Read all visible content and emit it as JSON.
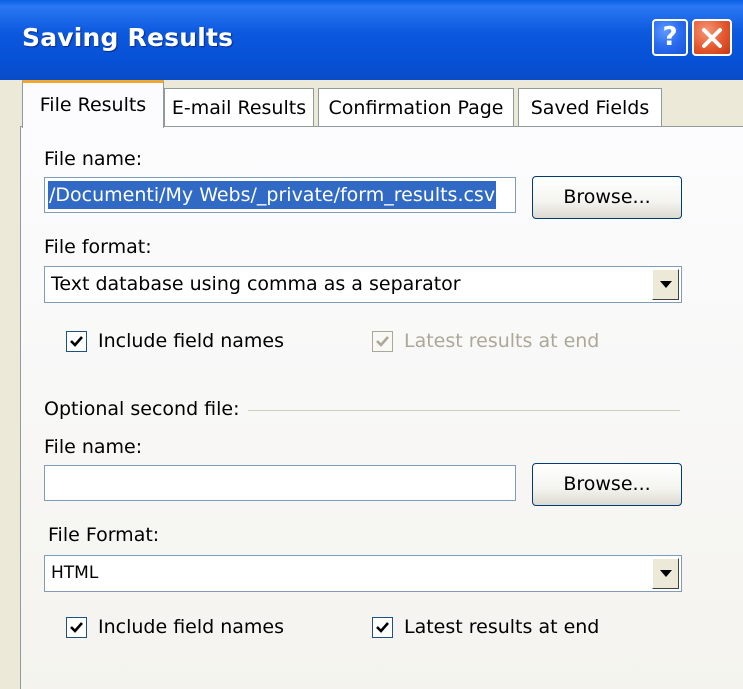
{
  "window": {
    "title": "Saving Results",
    "help_label": "?"
  },
  "tabs": [
    {
      "label": "File Results",
      "active": true
    },
    {
      "label": "E-mail Results",
      "active": false
    },
    {
      "label": "Confirmation Page",
      "active": false
    },
    {
      "label": "Saved Fields",
      "active": false
    }
  ],
  "primary": {
    "file_name_label": "File name:",
    "file_name_value": "/Documenti/My Webs/_private/form_results.csv",
    "browse_label": "Browse...",
    "file_format_label": "File format:",
    "file_format_value": "Text database using comma as a separator",
    "include_field_names_label": "Include field names",
    "include_field_names_checked": true,
    "latest_results_label": "Latest results at end",
    "latest_results_checked": true,
    "latest_results_disabled": true
  },
  "secondary": {
    "group_label": "Optional second file:",
    "file_name_label": "File name:",
    "file_name_value": "",
    "browse_label": "Browse...",
    "file_format_label": "File Format:",
    "file_format_value": "HTML",
    "include_field_names_label": "Include field names",
    "include_field_names_checked": true,
    "latest_results_label": "Latest results at end",
    "latest_results_checked": true
  },
  "colors": {
    "titlebar": "#0a5fe4",
    "selection": "#316ac5",
    "active_tab_accent": "#f0a830",
    "close_button": "#e4582e"
  }
}
